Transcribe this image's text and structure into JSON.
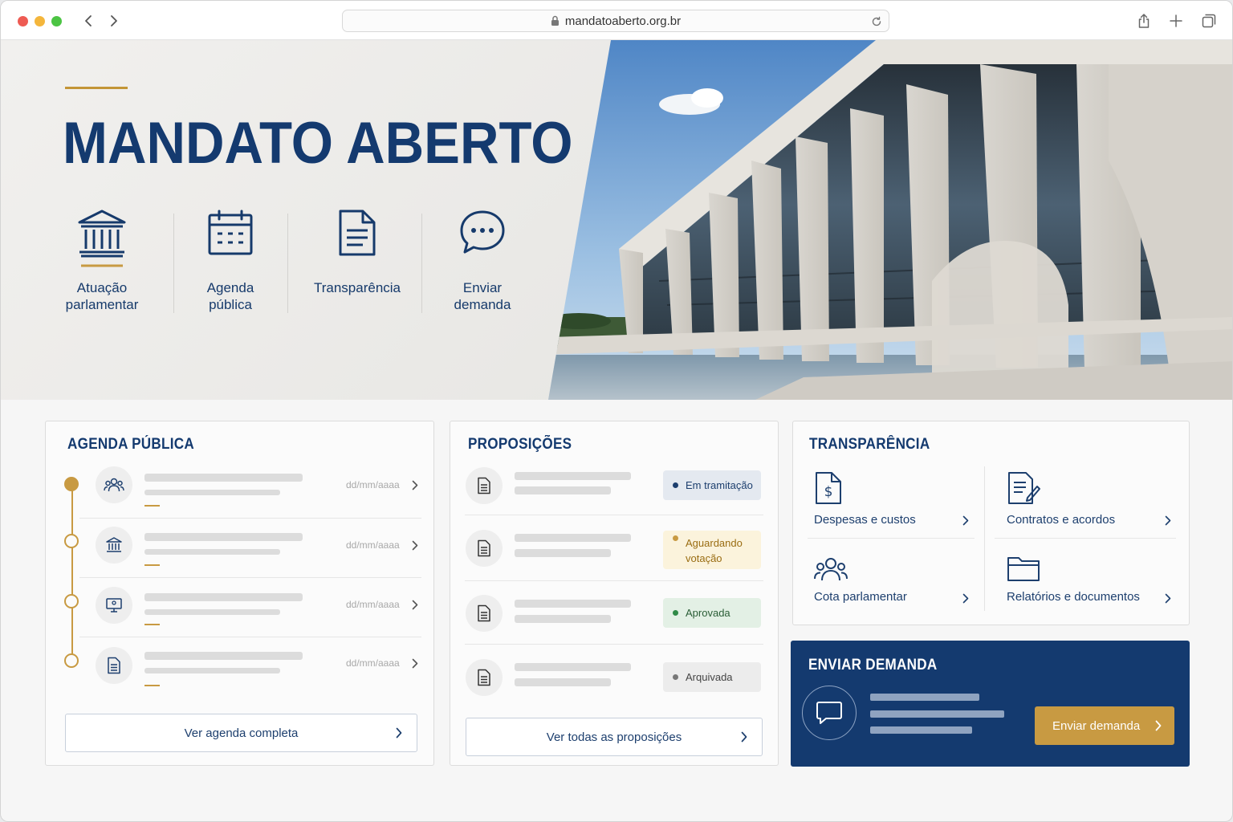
{
  "browser": {
    "url": "mandatoaberto.org.br"
  },
  "hero": {
    "title": "MANDATO ABERTO",
    "quick_links": [
      {
        "line1": "Atuação",
        "line2": "parlamentar",
        "icon": "government-building-icon"
      },
      {
        "line1": "Agenda",
        "line2": "pública",
        "icon": "calendar-icon"
      },
      {
        "line1": "Transparência",
        "line2": "",
        "icon": "document-icon"
      },
      {
        "line1": "Enviar",
        "line2": "demanda",
        "icon": "chat-bubble-icon"
      }
    ]
  },
  "agenda": {
    "title": "AGENDA PÚBLICA",
    "items": [
      {
        "date": "dd/mm/aaaa",
        "icon": "people-icon"
      },
      {
        "date": "dd/mm/aaaa",
        "icon": "building-icon"
      },
      {
        "date": "dd/mm/aaaa",
        "icon": "monitor-icon"
      },
      {
        "date": "dd/mm/aaaa",
        "icon": "document-icon"
      }
    ],
    "button": "Ver agenda completa"
  },
  "proposicoes": {
    "title": "PROPOSIÇÕES",
    "items": [
      {
        "status_line1": "Em tramitação",
        "status_line2": "",
        "status_color": "#1d3f6e"
      },
      {
        "status_line1": "Aguardando",
        "status_line2": "votação",
        "status_color": "#c89a42"
      },
      {
        "status_line1": "Aprovada",
        "status_line2": "",
        "status_color": "#2f8a47"
      },
      {
        "status_line1": "Arquivada",
        "status_line2": "",
        "status_color": "#777777"
      }
    ],
    "button": "Ver todas as proposições"
  },
  "transparencia": {
    "title": "TRANSPARÊNCIA",
    "items": [
      {
        "label": "Despesas e custos",
        "icon": "dollar-document-icon"
      },
      {
        "label": "Contratos e acordos",
        "icon": "contract-pen-icon"
      },
      {
        "label": "Cota parlamentar",
        "icon": "group-icon"
      },
      {
        "label": "Relatórios e documentos",
        "icon": "folder-icon"
      }
    ]
  },
  "demanda": {
    "title": "ENVIAR DEMANDA",
    "button": "Enviar demanda",
    "icon": "chat-icon"
  },
  "colors": {
    "brand_navy": "#143a6f",
    "accent_gold": "#c89a42"
  }
}
